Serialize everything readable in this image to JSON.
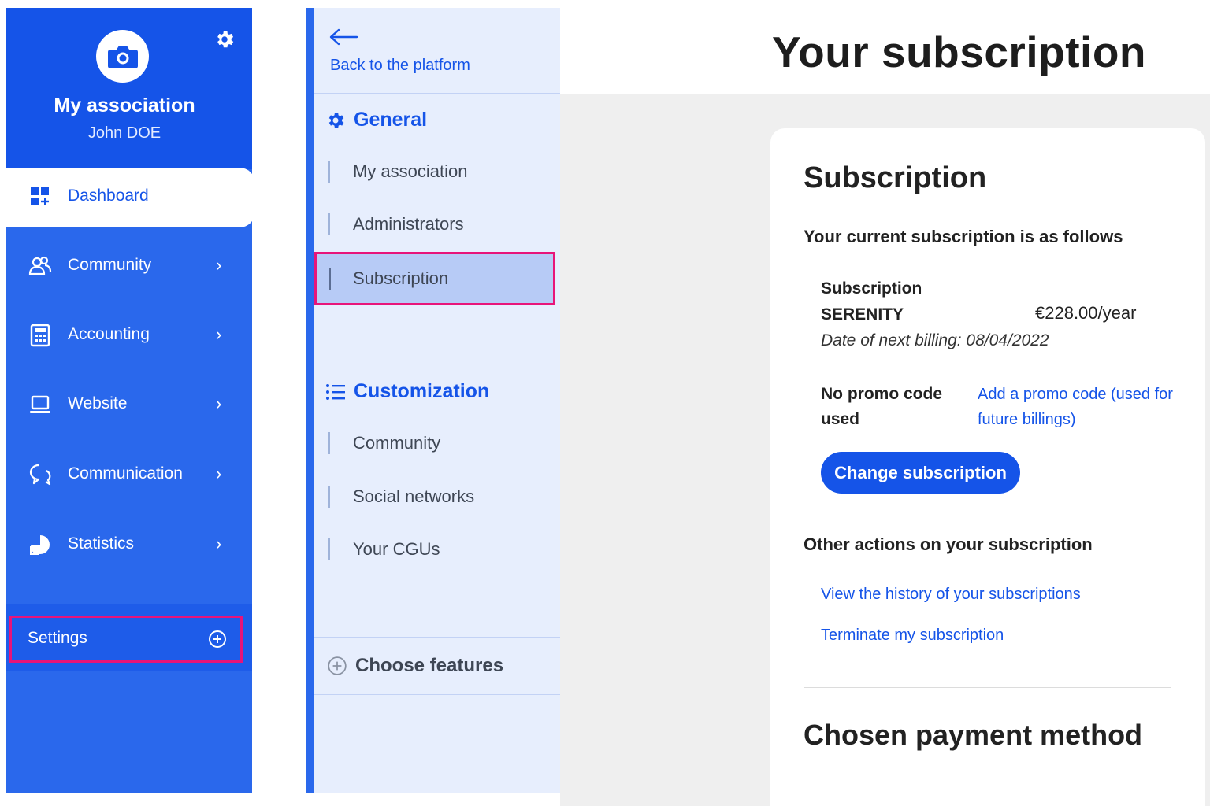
{
  "sidebar": {
    "org_name": "My association",
    "user_name": "John DOE",
    "dashboard_label": "Dashboard",
    "items": [
      {
        "label": "Community",
        "icon": "users-icon"
      },
      {
        "label": "Accounting",
        "icon": "calculator-icon"
      },
      {
        "label": "Website",
        "icon": "laptop-icon"
      },
      {
        "label": "Communication",
        "icon": "chat-bubbles-icon"
      },
      {
        "label": "Statistics",
        "icon": "pie-chart-icon"
      }
    ],
    "chevron": "›",
    "settings_label": "Settings"
  },
  "menu": {
    "back_label": "Back to the platform",
    "general_heading": "General",
    "general_items": [
      "My association",
      "Administrators",
      "Subscription"
    ],
    "custom_heading": "Customization",
    "custom_items": [
      "Community",
      "Social networks",
      "Your CGUs"
    ],
    "choose_label": "Choose features",
    "active_item": "Subscription"
  },
  "main": {
    "page_title": "Your subscription",
    "card_title": "Subscription",
    "intro": "Your current subscription is as follows",
    "plan_label": "Subscription",
    "plan_name": "SERENITY",
    "plan_price": "€228.00/year",
    "next_billing": "Date of next billing: 08/04/2022",
    "promo_none": "No promo code used",
    "promo_add": "Add a promo code (used for future billings)",
    "change_button": "Change subscription",
    "other_heading": "Other actions on your subscription",
    "history_link": "View the history of your subscriptions",
    "terminate_link": "Terminate my subscription",
    "payment_heading": "Chosen payment method"
  },
  "colors": {
    "brand_blue": "#1554e8",
    "sidebar_blue": "#2a68ec",
    "menu_bg": "#e7eefd",
    "highlight": "#e8147a"
  }
}
